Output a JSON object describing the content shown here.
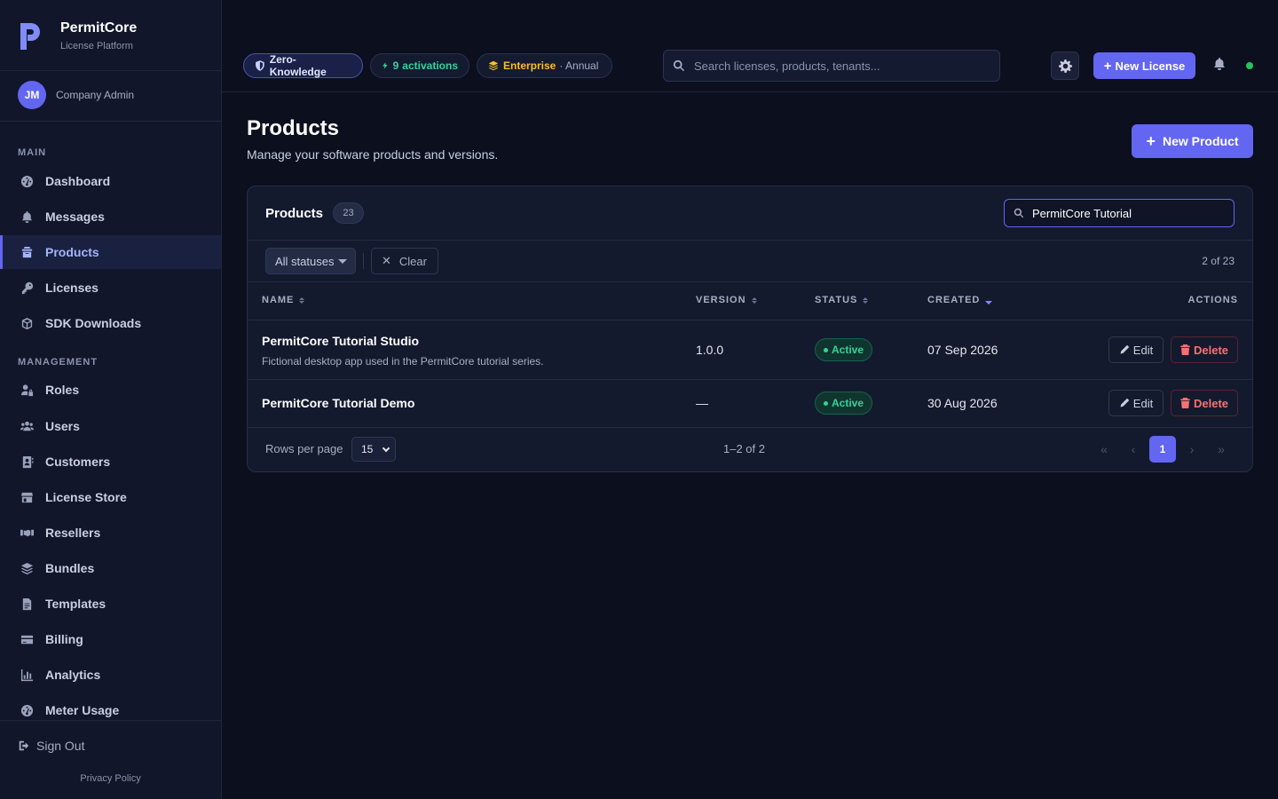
{
  "brand": {
    "name": "PermitCore",
    "subtitle": "License Platform"
  },
  "user": {
    "initials": "JM",
    "role": "Company Admin"
  },
  "sidebar": {
    "sections": [
      {
        "label": "MAIN",
        "items": [
          "Dashboard",
          "Messages",
          "Products",
          "Licenses",
          "SDK Downloads"
        ]
      },
      {
        "label": "MANAGEMENT",
        "items": [
          "Roles",
          "Users",
          "Customers",
          "License Store",
          "Resellers",
          "Bundles",
          "Templates",
          "Billing",
          "Analytics",
          "Meter Usage"
        ]
      }
    ],
    "active": "Products",
    "sign_out": "Sign Out",
    "privacy": "Privacy Policy"
  },
  "topbar": {
    "zk_label": "Zero-Knowledge",
    "activations_count": "9",
    "activations_label": "activations",
    "plan_name": "Enterprise",
    "plan_term": "· Annual",
    "search_placeholder": "Search licenses, products, tenants...",
    "new_license": "New License"
  },
  "page": {
    "title": "Products",
    "subtitle": "Manage your software products and versions.",
    "new_product": "New Product"
  },
  "card": {
    "title": "Products",
    "count": "23",
    "search_value": "PermitCore Tutorial",
    "status_filter": "All statuses",
    "clear": "Clear",
    "result_count": "2 of 23",
    "columns": {
      "name": "NAME",
      "version": "VERSION",
      "status": "STATUS",
      "created": "CREATED",
      "actions": "ACTIONS"
    },
    "rows": [
      {
        "name": "PermitCore Tutorial Studio",
        "description": "Fictional desktop app used in the PermitCore tutorial series.",
        "version": "1.0.0",
        "status": "Active",
        "created": "07 Sep 2026"
      },
      {
        "name": "PermitCore Tutorial Demo",
        "description": "",
        "version": "—",
        "status": "Active",
        "created": "30 Aug 2026"
      }
    ],
    "edit_label": "Edit",
    "delete_label": "Delete",
    "rows_per_page_label": "Rows per page",
    "rows_per_page": "15",
    "range": "1–2 of 2",
    "current_page": "1"
  },
  "colors": {
    "accent": "#6366f1",
    "success": "#34d399",
    "danger": "#f87171",
    "warning": "#fbbf24"
  }
}
